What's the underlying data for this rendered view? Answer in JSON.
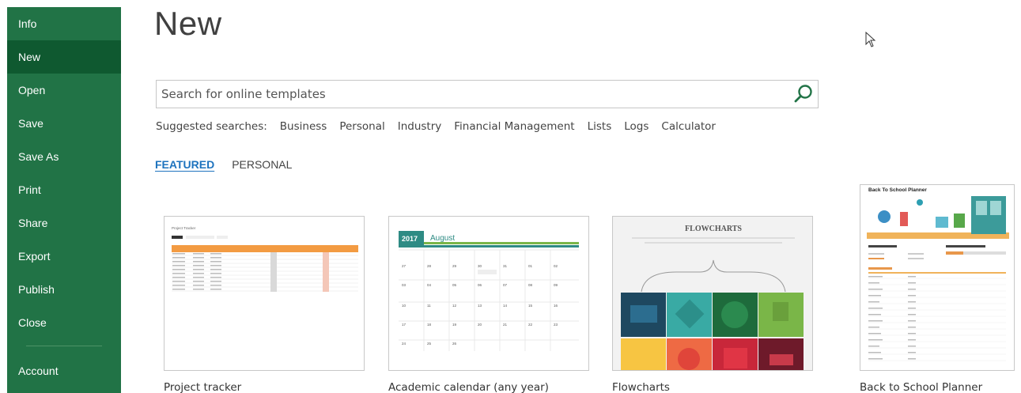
{
  "sidebar": {
    "items": [
      {
        "label": "Info"
      },
      {
        "label": "New"
      },
      {
        "label": "Open"
      },
      {
        "label": "Save"
      },
      {
        "label": "Save As"
      },
      {
        "label": "Print"
      },
      {
        "label": "Share"
      },
      {
        "label": "Export"
      },
      {
        "label": "Publish"
      },
      {
        "label": "Close"
      }
    ],
    "account": "Account",
    "active": "New"
  },
  "page": {
    "title": "New"
  },
  "search": {
    "placeholder": "Search for online templates",
    "icon": "search-icon"
  },
  "suggested": {
    "label": "Suggested searches:",
    "links": [
      "Business",
      "Personal",
      "Industry",
      "Financial Management",
      "Lists",
      "Logs",
      "Calculator"
    ]
  },
  "tabs": {
    "featured": "FEATURED",
    "personal": "PERSONAL"
  },
  "templates": [
    {
      "name": "Project tracker",
      "preview_title": "Project Tracker"
    },
    {
      "name": "Academic calendar (any year)",
      "year": "2017",
      "month": "August"
    },
    {
      "name": "Flowcharts",
      "preview_title": "FLOWCHARTS"
    },
    {
      "name": "Back to School Planner",
      "preview_title": "Back To School Planner"
    }
  ],
  "colors": {
    "accent": "#217346",
    "accent_dark": "#0f5930",
    "link": "#1e73be"
  }
}
